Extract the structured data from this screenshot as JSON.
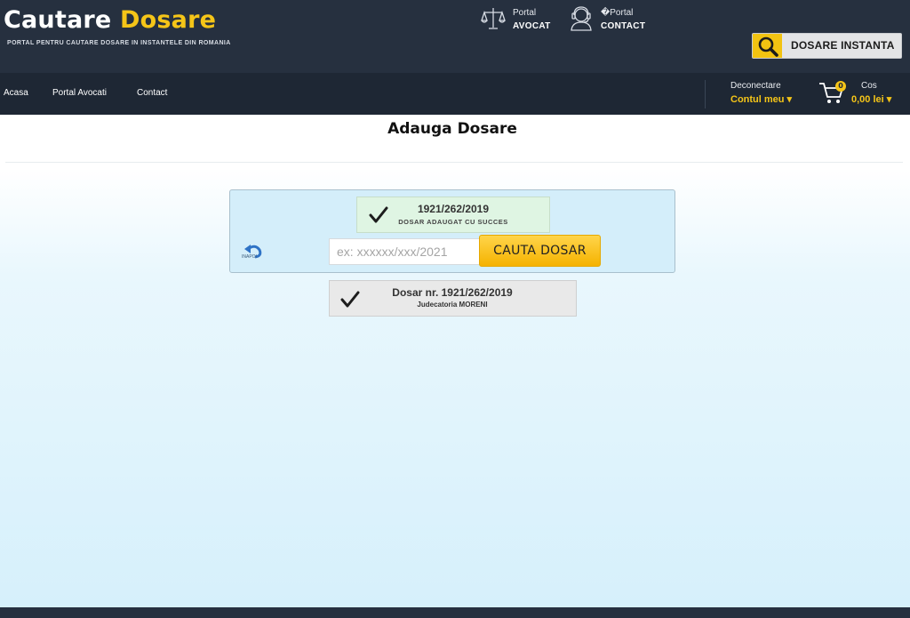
{
  "header": {
    "logo_white": "Cautare",
    "logo_yellow": "Dosare",
    "tagline": "PORTAL PENTRU CAUTARE DOSARE IN INSTANTELE DIN ROMANIA",
    "portal_avocat": {
      "line1": "Portal",
      "line2": "AVOCAT",
      "icon": "scales-icon"
    },
    "portal_contact": {
      "line1": "�Portal",
      "line2": "CONTACT",
      "icon": "support-agent-icon"
    },
    "instanta_button": {
      "label": "DOSARE INSTANTA",
      "icon": "magnifier-icon"
    }
  },
  "nav": {
    "items": [
      "Acasa",
      "Portal Avocati",
      "Contact"
    ],
    "account": {
      "top": "Deconectare",
      "bottom": "Contul meu ▾"
    },
    "cart": {
      "count": "0",
      "top": "Cos",
      "bottom": "0,00 lei ▾",
      "icon": "cart-icon"
    }
  },
  "main": {
    "title": "Adauga Dosare",
    "success": {
      "number": "1921/262/2019",
      "message": "DOSAR ADAUGAT CU SUCCES"
    },
    "back": {
      "label": "INAPOI",
      "icon": "back-arrow-icon"
    },
    "search": {
      "placeholder": "ex: xxxxxx/xxx/2021",
      "value": "",
      "button": "CAUTA DOSAR"
    },
    "result": {
      "title": "Dosar nr. 1921/262/2019",
      "court": "Judecatoria MORENI"
    }
  },
  "colors": {
    "header_bg": "#26303f",
    "nav_bg": "#1e2734",
    "accent": "#f5c518",
    "button": "#f5b300"
  }
}
